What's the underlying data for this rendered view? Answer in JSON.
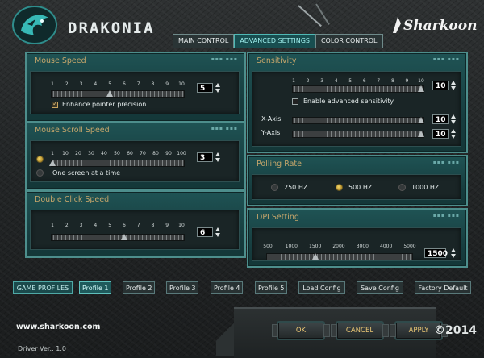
{
  "header": {
    "brand": "DRAKONIA",
    "vendor": "Sharkoon"
  },
  "tabs": [
    {
      "label": "MAIN CONTROL",
      "active": false
    },
    {
      "label": "ADVANCED SETTINGS",
      "active": true
    },
    {
      "label": "COLOR CONTROL",
      "active": false
    }
  ],
  "mouse_speed": {
    "title": "Mouse Speed",
    "ticks": [
      "1",
      "2",
      "3",
      "4",
      "5",
      "6",
      "7",
      "8",
      "9",
      "10"
    ],
    "value": "5",
    "position": 5,
    "enhance_label": "Enhance pointer precision",
    "enhance_checked": true
  },
  "scroll_speed": {
    "title": "Mouse Scroll Speed",
    "ticks": [
      "1",
      "10",
      "20",
      "30",
      "40",
      "50",
      "60",
      "70",
      "80",
      "90",
      "100"
    ],
    "value": "3",
    "position": 1,
    "one_screen_label": "One screen at a time",
    "lines_selected": true
  },
  "double_click": {
    "title": "Double Click Speed",
    "ticks": [
      "1",
      "2",
      "3",
      "4",
      "5",
      "6",
      "7",
      "8",
      "9",
      "10"
    ],
    "value": "6",
    "position": 6
  },
  "sensitivity": {
    "title": "Sensitivity",
    "ticks": [
      "1",
      "2",
      "3",
      "4",
      "5",
      "6",
      "7",
      "8",
      "9",
      "10"
    ],
    "value": "10",
    "advanced_label": "Enable advanced sensitivity",
    "advanced_checked": false,
    "x_label": "X-Axis",
    "x_value": "10",
    "y_label": "Y-Axis",
    "y_value": "10"
  },
  "polling": {
    "title": "Polling Rate",
    "options": [
      "250 HZ",
      "500 HZ",
      "1000 HZ"
    ],
    "selected": "500 HZ"
  },
  "dpi": {
    "title": "DPI Setting",
    "ticks": [
      "500",
      "1000",
      "1500",
      "2000",
      "3000",
      "4000",
      "5000"
    ],
    "value": "1500",
    "position": 3
  },
  "profiles": {
    "label": "GAME PROFILES",
    "items": [
      "Profile 1",
      "Profile 2",
      "Profile 3",
      "Profile 4",
      "Profile 5"
    ],
    "active": "Profile 1",
    "load": "Load Config",
    "save": "Save Config",
    "factory": "Factory Default"
  },
  "footer": {
    "url": "www.sharkoon.com",
    "driver": "Driver Ver.: 1.0",
    "ok": "OK",
    "cancel": "CANCEL",
    "apply": "APPLY",
    "copyright": "©2014"
  }
}
